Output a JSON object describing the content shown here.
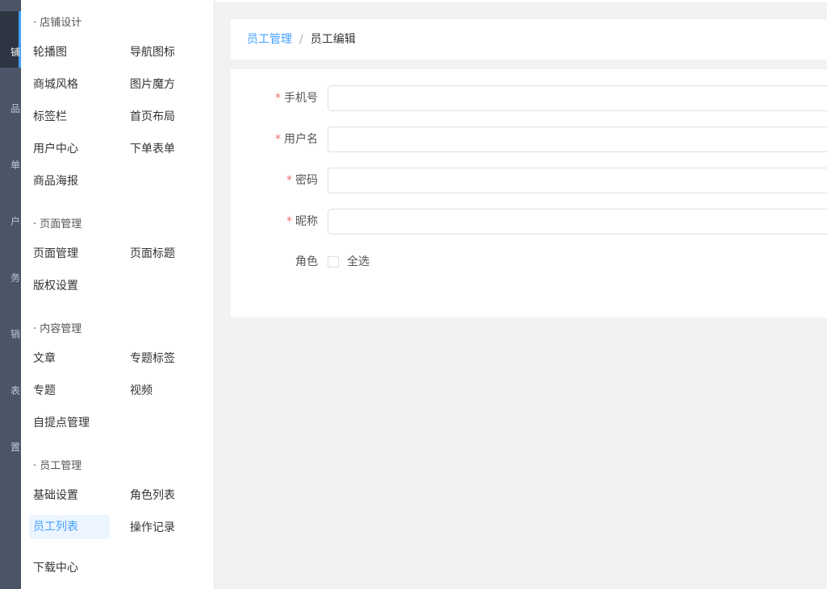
{
  "rail": {
    "glyphs": [
      "铺",
      "品",
      "单",
      "户",
      "务",
      "销",
      "表",
      "置"
    ]
  },
  "submenu": {
    "groups": [
      {
        "title": "· 店铺设计",
        "items": [
          "轮播图",
          "导航图标",
          "商城风格",
          "图片魔方",
          "标签栏",
          "首页布局",
          "用户中心",
          "下单表单",
          "商品海报"
        ]
      },
      {
        "title": "· 页面管理",
        "items": [
          "页面管理",
          "页面标题",
          "版权设置"
        ]
      },
      {
        "title": "· 内容管理",
        "items": [
          "文章",
          "专题标签",
          "专题",
          "视频",
          "自提点管理"
        ]
      },
      {
        "title": "· 员工管理",
        "items": [
          "基础设置",
          "角色列表",
          "员工列表",
          "操作记录"
        ]
      }
    ],
    "standalone": "下载中心"
  },
  "breadcrumb": {
    "parent": "员工管理",
    "separator": "/",
    "current": "员工编辑"
  },
  "form": {
    "fields": [
      {
        "label": "手机号",
        "required": "*",
        "value": ""
      },
      {
        "label": "用户名",
        "required": "*",
        "value": ""
      },
      {
        "label": "密码",
        "required": "*",
        "value": ""
      },
      {
        "label": "昵称",
        "required": "*",
        "value": ""
      }
    ],
    "role_label": "角色",
    "select_all": "全选"
  },
  "colors": {
    "accent": "#409eff",
    "required": "#f56c6c",
    "rail": "#4b5567",
    "rail_active": "#2d3442"
  }
}
